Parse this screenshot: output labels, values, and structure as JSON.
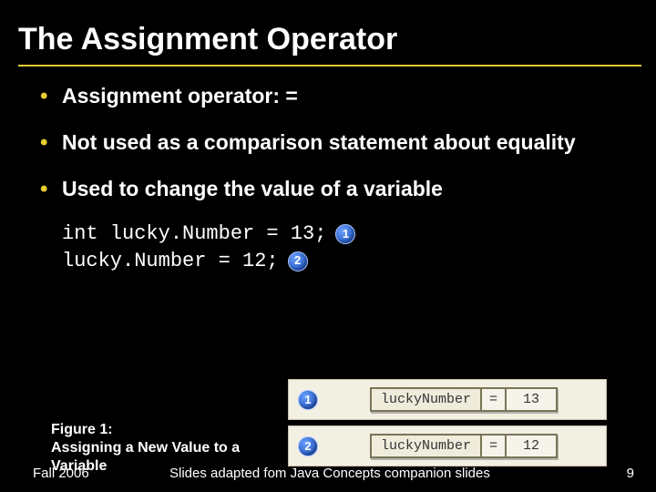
{
  "title": "The Assignment Operator",
  "bullets": [
    "Assignment operator: =",
    "Not used as a comparison statement about equality",
    "Used to change the value of a variable"
  ],
  "code": {
    "line1": "int lucky.Number = 13;",
    "line2": "lucky.Number = 12;",
    "badge1": "1",
    "badge2": "2"
  },
  "figure": {
    "caption_line1": "Figure 1:",
    "caption_line2": "Assigning a New Value to a",
    "caption_line3": "Variable",
    "rows": [
      {
        "badge": "1",
        "var": "luckyNumber",
        "eq": "=",
        "val": "13"
      },
      {
        "badge": "2",
        "var": "luckyNumber",
        "eq": "=",
        "val": "12"
      }
    ]
  },
  "footer": {
    "left": "Fall 2006",
    "center": "Slides adapted fom Java Concepts companion slides",
    "page": "9"
  }
}
